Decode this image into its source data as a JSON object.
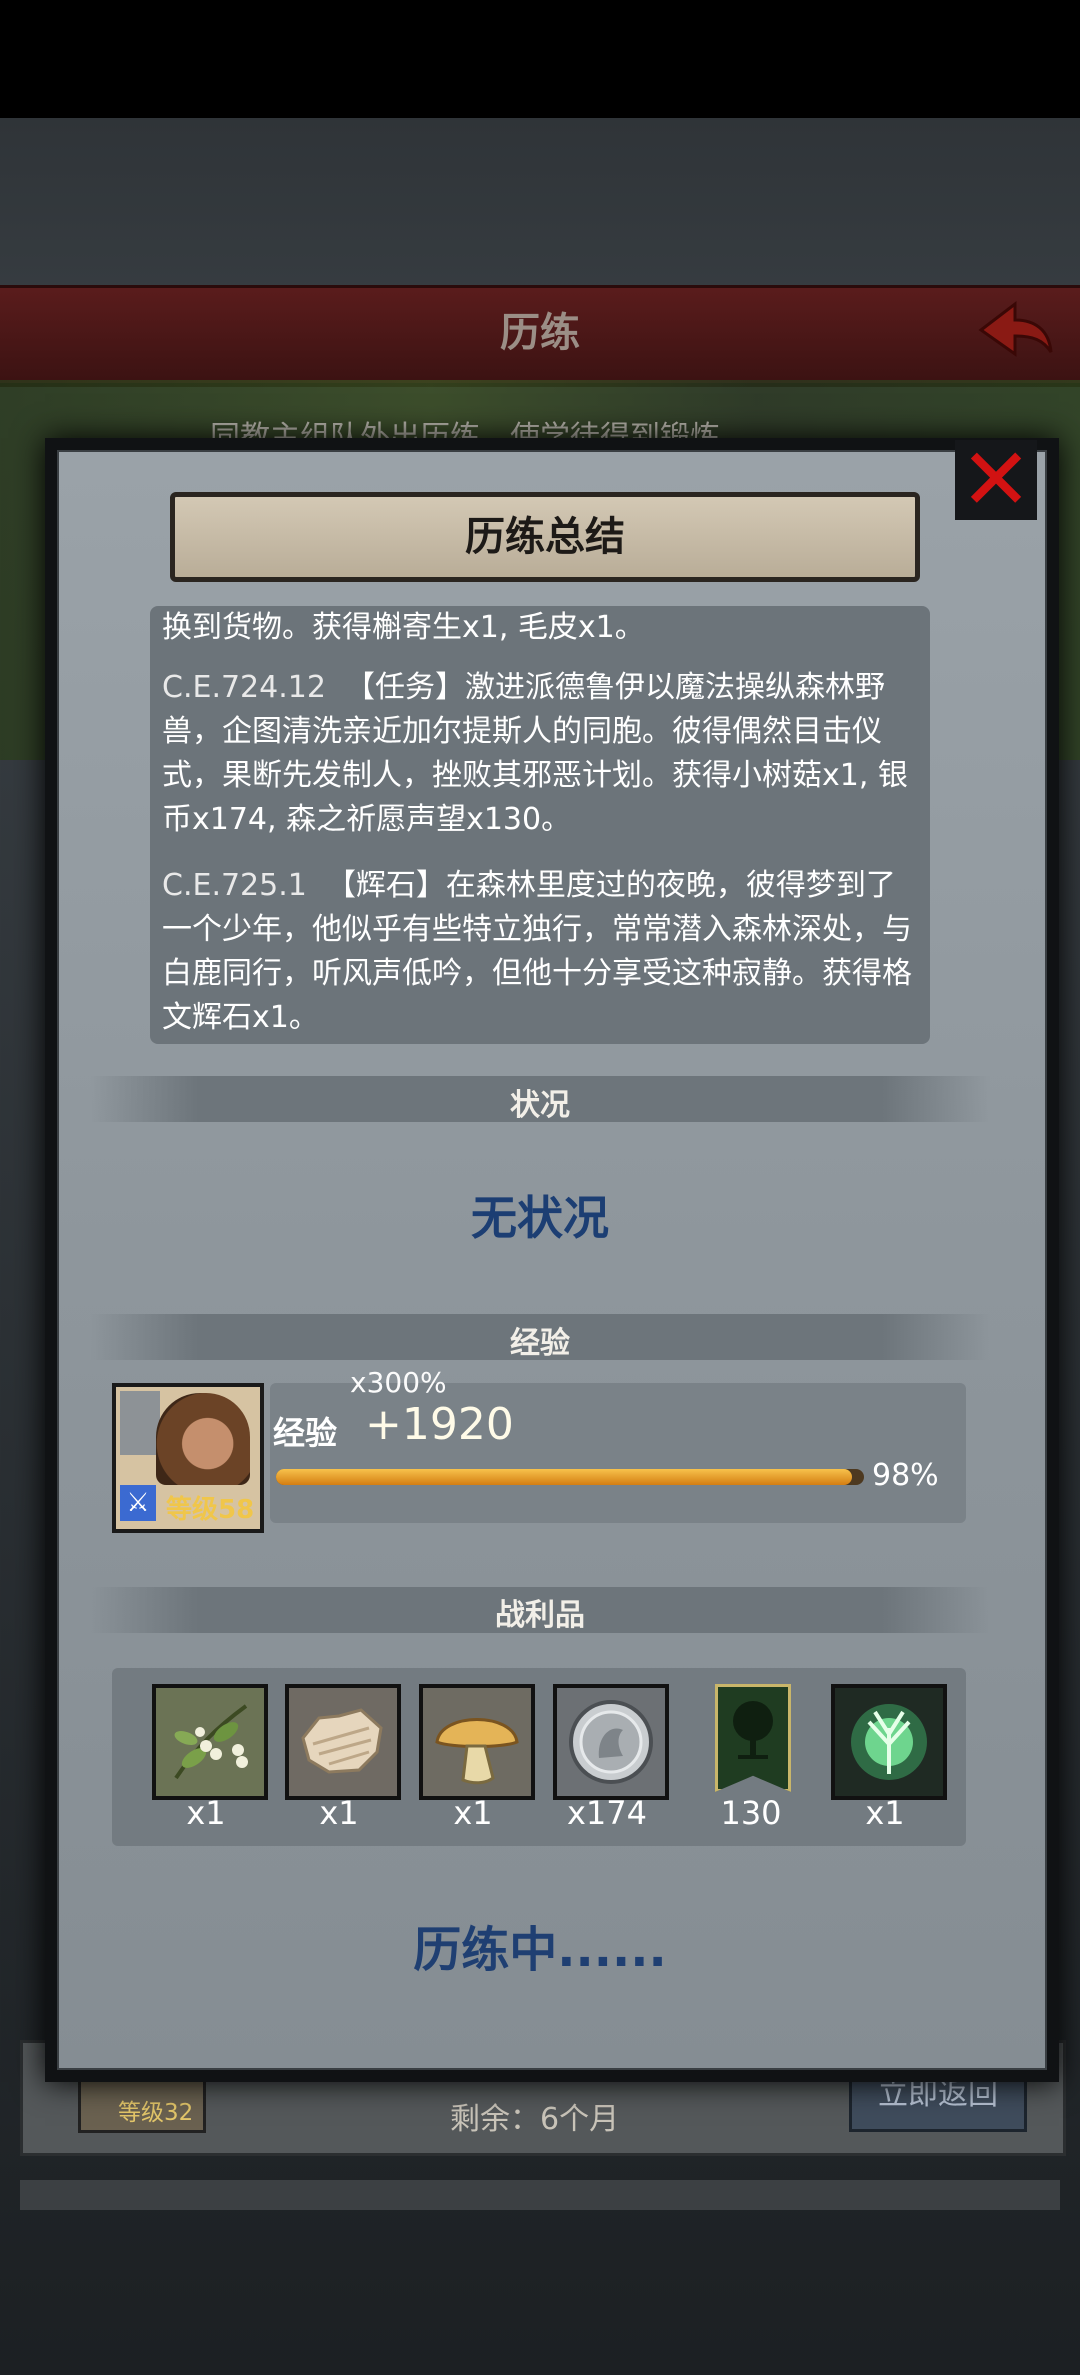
{
  "background_screen": {
    "title": "历练",
    "description": "同教主组队外出历练，使学徒得到锻炼",
    "level_badge": "等级32",
    "remaining": "剩余：6个月",
    "return_button": "立即返回",
    "progress": 0.33
  },
  "modal": {
    "title": "历练总结",
    "log": [
      {
        "date": "",
        "text": "换到货物。获得槲寄生x1, 毛皮x1。"
      },
      {
        "date": "C.E.724.12",
        "text": "【任务】激进派德鲁伊以魔法操纵森林野兽，企图清洗亲近加尔提斯人的同胞。彼得偶然目击仪式，果断先发制人，挫败其邪恶计划。获得小树菇x1, 银币x174, 森之祈愿声望x130。"
      },
      {
        "date": "C.E.725.1",
        "text": "【辉石】在森林里度过的夜晚，彼得梦到了一个少年，他似乎有些特立独行，常常潜入森林深处，与白鹿同行，听风声低吟，但他十分享受这种寂静。获得格文辉石x1。"
      }
    ],
    "status_header": "状况",
    "status_value": "无状况",
    "exp_header": "经验",
    "exp": {
      "multiplier": "x300%",
      "label": "经验",
      "value": "+1920",
      "percent_text": "98%",
      "fill": 0.98,
      "level": "等级58"
    },
    "loot_header": "战利品",
    "loot": [
      {
        "icon": "mistletoe-icon",
        "count": "x1"
      },
      {
        "icon": "fur-icon",
        "count": "x1"
      },
      {
        "icon": "mushroom-icon",
        "count": "x1"
      },
      {
        "icon": "silver-coin-icon",
        "count": "x174"
      },
      {
        "icon": "forest-banner-icon",
        "count": "130"
      },
      {
        "icon": "glowing-stone-icon",
        "count": "x1"
      }
    ],
    "footer_status": "历练中......"
  }
}
